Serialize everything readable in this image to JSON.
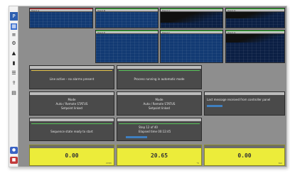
{
  "toolbar": {
    "logo": "P",
    "buttons": [
      "grid",
      "layers",
      "gear",
      "alert",
      "book",
      "list",
      "upload",
      "doc"
    ],
    "bottom_buttons": [
      "bell",
      "export"
    ]
  },
  "trend_panels": [
    {
      "header": "Trend A"
    },
    {
      "header": "Trend B"
    },
    {
      "header": "Trend C"
    },
    {
      "header": "Trend D"
    },
    {
      "header": "Trend E"
    },
    {
      "header": "Trend F"
    },
    {
      "header": "Trend G"
    }
  ],
  "status_panels": [
    {
      "text": "Line active – no alarms present"
    },
    {
      "text": "Process running in automatic mode"
    }
  ],
  "info_panels": [
    {
      "lines": [
        "Mode",
        "Auto / Remote STATUS",
        "Setpoint linked"
      ]
    },
    {
      "lines": [
        "Mode",
        "Auto / Remote STATUS",
        "Setpoint linked"
      ]
    },
    {
      "lines": [
        "Last message received from controller panel"
      ]
    }
  ],
  "lower_panels": [
    {
      "text": "Sequence state ready to start"
    },
    {
      "lines": [
        "Step 12 of 40",
        "Elapsed time 00:12:45"
      ]
    }
  ],
  "values": [
    {
      "value": "0.00",
      "unit": "m3/h"
    },
    {
      "value": "20.65",
      "unit": "°C"
    },
    {
      "value": "0.00",
      "unit": "bar"
    }
  ],
  "colors": {
    "trend_bg": "#123a73",
    "value_bg": "#ecec3a",
    "app_bg": "#8e8e8e"
  }
}
